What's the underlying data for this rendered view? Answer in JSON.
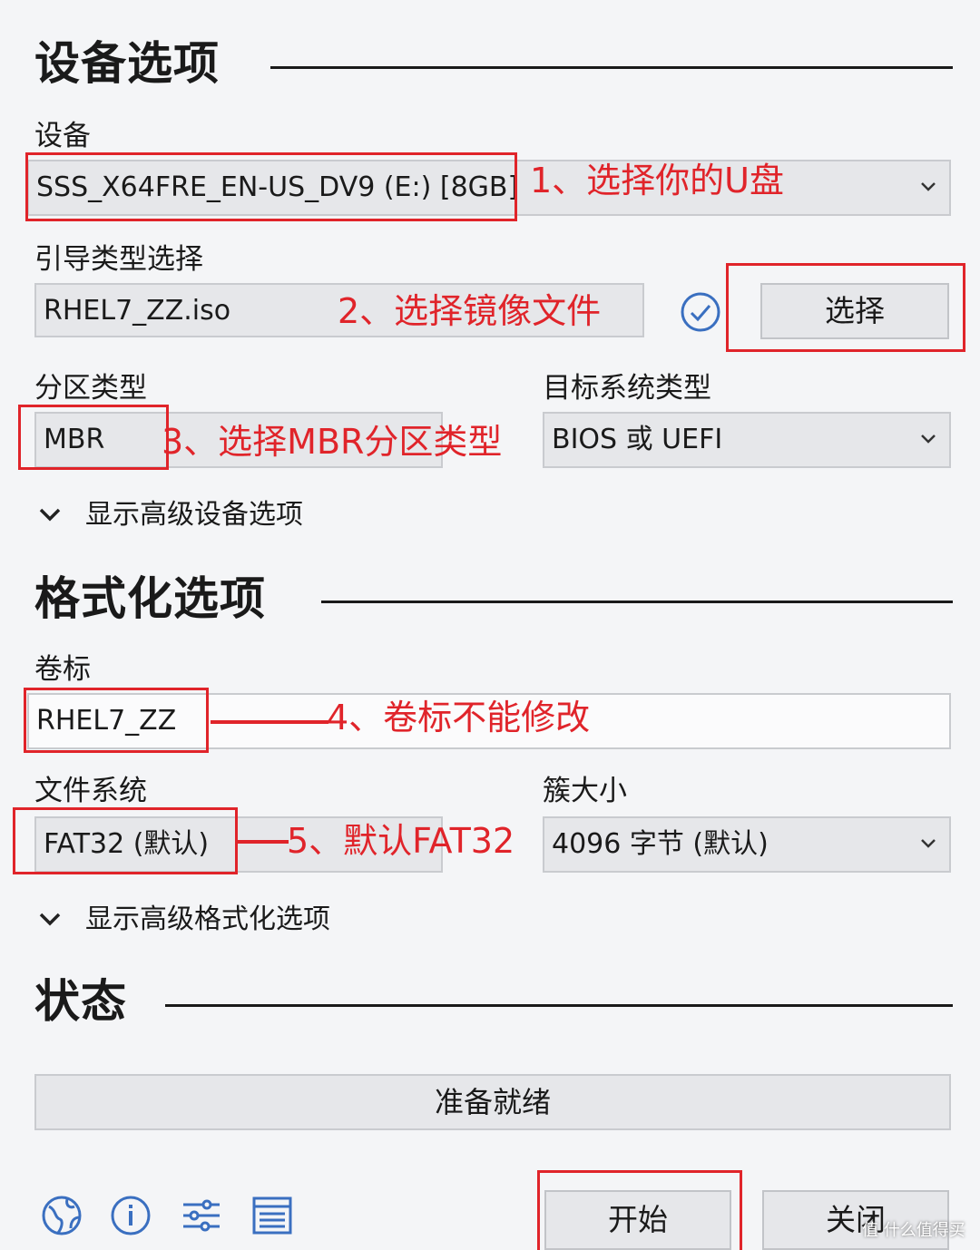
{
  "device_section": {
    "title": "设备选项",
    "device_label": "设备",
    "device_value": "SSS_X64FRE_EN-US_DV9 (E:) [8GB]",
    "boot_label": "引导类型选择",
    "boot_value": "RHEL7_ZZ.iso",
    "select_button": "选择",
    "partition_label": "分区类型",
    "partition_value": "MBR",
    "target_label": "目标系统类型",
    "target_value": "BIOS 或 UEFI",
    "advanced_toggle": "显示高级设备选项"
  },
  "format_section": {
    "title": "格式化选项",
    "volume_label": "卷标",
    "volume_value": "RHEL7_ZZ",
    "fs_label": "文件系统",
    "fs_value": "FAT32 (默认)",
    "cluster_label": "簇大小",
    "cluster_value": "4096 字节 (默认)",
    "advanced_toggle": "显示高级格式化选项"
  },
  "status_section": {
    "title": "状态",
    "status_text": "准备就绪"
  },
  "footer": {
    "start_button": "开始",
    "close_button": "关闭",
    "icons": [
      "globe-icon",
      "info-icon",
      "settings-sliders-icon",
      "log-icon"
    ]
  },
  "annotations": {
    "note1": "1、选择你的U盘",
    "note2": "2、选择镜像文件",
    "note3": "3、选择MBR分区类型",
    "note4": "4、卷标不能修改",
    "note5": "5、默认FAT32"
  },
  "watermark": "值 什么值得买",
  "colors": {
    "annotation_red": "#e0242a",
    "check_blue": "#3a6fc0",
    "background": "#f4f5f7"
  }
}
